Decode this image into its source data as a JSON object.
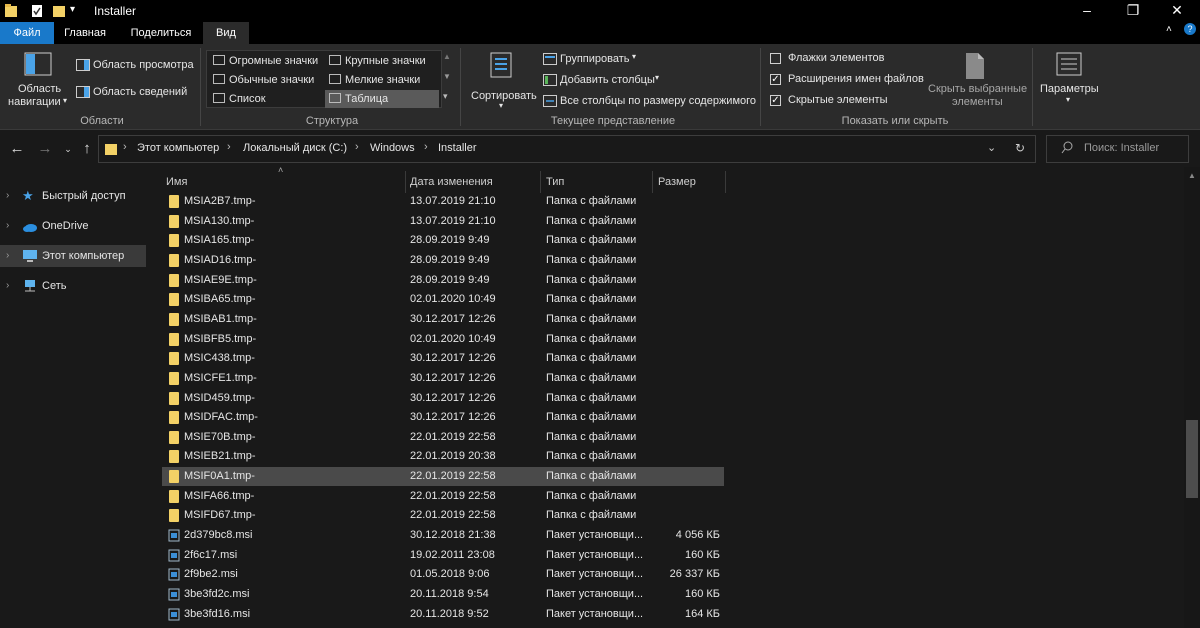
{
  "window": {
    "title": "Installer"
  },
  "tabs": [
    "Файл",
    "Главная",
    "Поделиться",
    "Вид"
  ],
  "ribbon": {
    "panes": {
      "nav_pane_line1": "Область",
      "nav_pane_line2": "навигации",
      "preview_pane": "Область просмотра",
      "details_pane": "Область сведений",
      "group_label": "Области"
    },
    "layout": {
      "items": [
        "Огромные значки",
        "Крупные значки",
        "Обычные значки",
        "Мелкие значки",
        "Список",
        "Таблица"
      ],
      "selected": "Таблица",
      "group_label": "Структура"
    },
    "current_view": {
      "sort_label": "Сортировать",
      "group_by": "Группировать",
      "add_columns": "Добавить столбцы",
      "size_columns": "Все столбцы по размеру содержимого",
      "group_label": "Текущее представление"
    },
    "show_hide": {
      "item_checkboxes": "Флажки элементов",
      "file_extensions": "Расширения имен файлов",
      "hidden_items": "Скрытые элементы",
      "hide_selected_line1": "Скрыть выбранные",
      "hide_selected_line2": "элементы",
      "group_label": "Показать или скрыть",
      "checked": {
        "item_checkboxes": false,
        "file_extensions": true,
        "hidden_items": true
      }
    },
    "options_label": "Параметры"
  },
  "address": {
    "crumbs": [
      "Этот компьютер",
      "Локальный диск (C:)",
      "Windows",
      "Installer"
    ],
    "search_placeholder": "Поиск: Installer"
  },
  "sidebar": {
    "items": [
      "Быстрый доступ",
      "OneDrive",
      "Этот компьютер",
      "Сеть"
    ],
    "selected": "Этот компьютер"
  },
  "columns": [
    "Имя",
    "Дата изменения",
    "Тип",
    "Размер"
  ],
  "files": [
    {
      "name": "MSIA2B7.tmp-",
      "date": "13.07.2019 21:10",
      "type": "Папка с файлами",
      "size": "",
      "kind": "folder"
    },
    {
      "name": "MSIA130.tmp-",
      "date": "13.07.2019 21:10",
      "type": "Папка с файлами",
      "size": "",
      "kind": "folder"
    },
    {
      "name": "MSIA165.tmp-",
      "date": "28.09.2019 9:49",
      "type": "Папка с файлами",
      "size": "",
      "kind": "folder"
    },
    {
      "name": "MSIAD16.tmp-",
      "date": "28.09.2019 9:49",
      "type": "Папка с файлами",
      "size": "",
      "kind": "folder"
    },
    {
      "name": "MSIAE9E.tmp-",
      "date": "28.09.2019 9:49",
      "type": "Папка с файлами",
      "size": "",
      "kind": "folder"
    },
    {
      "name": "MSIBA65.tmp-",
      "date": "02.01.2020 10:49",
      "type": "Папка с файлами",
      "size": "",
      "kind": "folder"
    },
    {
      "name": "MSIBAB1.tmp-",
      "date": "30.12.2017 12:26",
      "type": "Папка с файлами",
      "size": "",
      "kind": "folder"
    },
    {
      "name": "MSIBFB5.tmp-",
      "date": "02.01.2020 10:49",
      "type": "Папка с файлами",
      "size": "",
      "kind": "folder"
    },
    {
      "name": "MSIC438.tmp-",
      "date": "30.12.2017 12:26",
      "type": "Папка с файлами",
      "size": "",
      "kind": "folder"
    },
    {
      "name": "MSICFE1.tmp-",
      "date": "30.12.2017 12:26",
      "type": "Папка с файлами",
      "size": "",
      "kind": "folder"
    },
    {
      "name": "MSID459.tmp-",
      "date": "30.12.2017 12:26",
      "type": "Папка с файлами",
      "size": "",
      "kind": "folder"
    },
    {
      "name": "MSIDFAC.tmp-",
      "date": "30.12.2017 12:26",
      "type": "Папка с файлами",
      "size": "",
      "kind": "folder"
    },
    {
      "name": "MSIE70B.tmp-",
      "date": "22.01.2019 22:58",
      "type": "Папка с файлами",
      "size": "",
      "kind": "folder"
    },
    {
      "name": "MSIEB21.tmp-",
      "date": "22.01.2019 20:38",
      "type": "Папка с файлами",
      "size": "",
      "kind": "folder"
    },
    {
      "name": "MSIF0A1.tmp-",
      "date": "22.01.2019 22:58",
      "type": "Папка с файлами",
      "size": "",
      "kind": "folder",
      "selected": true
    },
    {
      "name": "MSIFA66.tmp-",
      "date": "22.01.2019 22:58",
      "type": "Папка с файлами",
      "size": "",
      "kind": "folder"
    },
    {
      "name": "MSIFD67.tmp-",
      "date": "22.01.2019 22:58",
      "type": "Папка с файлами",
      "size": "",
      "kind": "folder"
    },
    {
      "name": "2d379bc8.msi",
      "date": "30.12.2018 21:38",
      "type": "Пакет установщи...",
      "size": "4 056 КБ",
      "kind": "msi"
    },
    {
      "name": "2f6c17.msi",
      "date": "19.02.2011 23:08",
      "type": "Пакет установщи...",
      "size": "160 КБ",
      "kind": "msi"
    },
    {
      "name": "2f9be2.msi",
      "date": "01.05.2018 9:06",
      "type": "Пакет установщи...",
      "size": "26 337 КБ",
      "kind": "msi"
    },
    {
      "name": "3be3fd2c.msi",
      "date": "20.11.2018 9:54",
      "type": "Пакет установщи...",
      "size": "160 КБ",
      "kind": "msi"
    },
    {
      "name": "3be3fd16.msi",
      "date": "20.11.2018 9:52",
      "type": "Пакет установщи...",
      "size": "164 КБ",
      "kind": "msi"
    }
  ]
}
